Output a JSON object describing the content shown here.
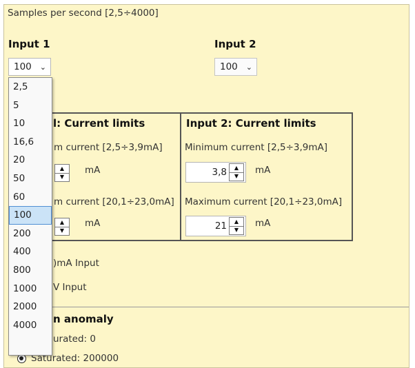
{
  "header": {
    "samples_label": "Samples per second [2,5÷4000]"
  },
  "input1": {
    "title": "Input 1",
    "rate_value": "100",
    "chevron_icon": "chevron-down"
  },
  "input2": {
    "title": "Input 2",
    "rate_value": "100",
    "chevron_icon": "chevron-down"
  },
  "dropdown": {
    "options": [
      "2,5",
      "5",
      "10",
      "16,6",
      "20",
      "50",
      "60",
      "100",
      "200",
      "400",
      "800",
      "1000",
      "2000",
      "4000"
    ],
    "selected": "100",
    "selected_color": "#cbe3f7"
  },
  "limits1": {
    "title_visible": "l: Current limits",
    "min_label_visible": "m current [2,5÷3,9mA]",
    "max_label_visible": "m current [20,1÷23,0mA]",
    "unit": "mA"
  },
  "limits2": {
    "title": "Input 2: Current limits",
    "min_label": "Minimum current [2,5÷3,9mA]",
    "min_value": "3,8",
    "max_label": "Maximum current [20,1÷23,0mA]",
    "max_value": "21",
    "unit": "mA"
  },
  "input_type": {
    "ma_label_visible": ")mA Input",
    "v_label_visible": "V Input"
  },
  "anomaly": {
    "title_visible": "n anomaly",
    "option1_visible": "urated: 0",
    "option2_visible": "Saturated: 200000"
  },
  "colors": {
    "panel": "#fdf6c8",
    "border": "#555555"
  }
}
